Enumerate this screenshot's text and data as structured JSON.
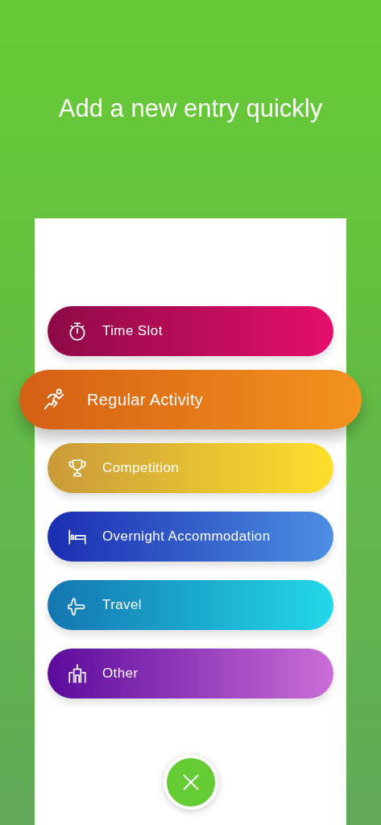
{
  "title": "Add a new entry quickly",
  "entries": [
    {
      "kind": "stopwatch",
      "label": "Time Slot",
      "selected": false,
      "color": "#8e0a47"
    },
    {
      "kind": "runner",
      "label": "Regular Activity",
      "selected": true,
      "color": "#d35f14"
    },
    {
      "kind": "trophy",
      "label": "Competition",
      "selected": false,
      "color": "#c99a3a"
    },
    {
      "kind": "bed",
      "label": "Overnight Accommodation",
      "selected": false,
      "color": "#1b2db1"
    },
    {
      "kind": "plane",
      "label": "Travel",
      "selected": false,
      "color": "#1475b0"
    },
    {
      "kind": "buildings",
      "label": "Other",
      "selected": false,
      "color": "#5b0a9c"
    }
  ]
}
